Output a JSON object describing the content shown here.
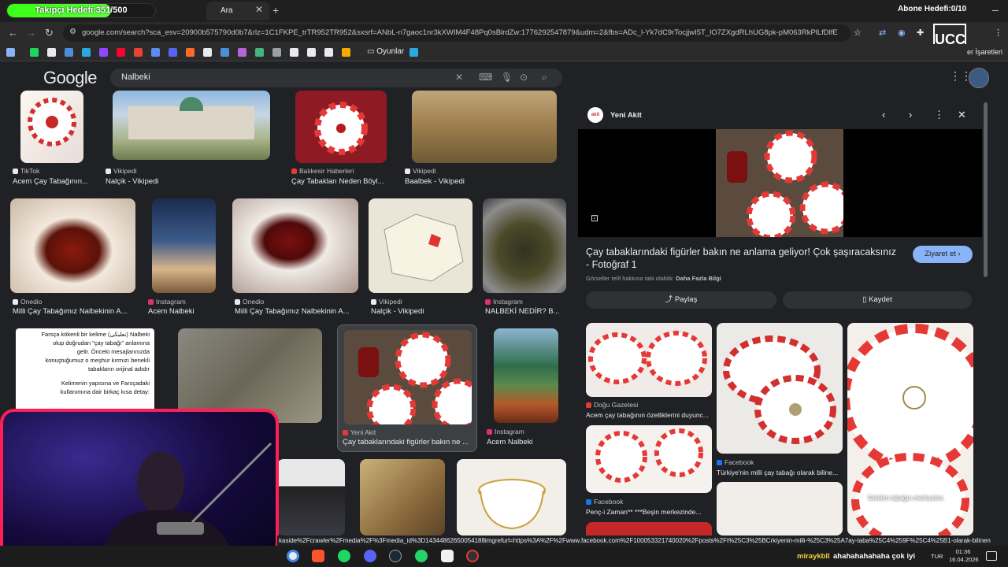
{
  "browser": {
    "goal_left": "Takipçi Hedefi:351/500",
    "goal_progress": 0.702,
    "tab_title": "Ara",
    "goal_right": "Abone Hedefi:0/10",
    "url": "google.com/search?sca_esv=20900b575790d0b7&rlz=1C1FKPE_trTR952TR952&sxsrf=ANbL-n7gaoc1nr3kXWIM4F48Pq0sBlrdZw:1776292547879&udm=2&fbs=ADc_l-Yk7dC9rTocjjwI5T_lO7ZXgdRLhUG8pk-pM063RkPlLfDlfEXPwaXG5e...",
    "bookmarks_folder": "Oyunlar",
    "other_bookmarks": "er İşaretleri"
  },
  "google": {
    "logo": "Google",
    "query": "Nalbeki"
  },
  "results": {
    "row1": [
      {
        "source": "TikTok",
        "title": "Acem Çay Tabağının..."
      },
      {
        "source": "Vikipedi",
        "title": "Nalçik - Vikipedi"
      },
      {
        "source": "Balıkesir Haberleri",
        "title": "Çay Tabakları Neden Böyl..."
      },
      {
        "source": "Vikipedi",
        "title": "Baalbek - Vikipedi"
      }
    ],
    "row2": [
      {
        "source": "Onedio",
        "title": "Milli Çay Tabağımız Nalbekinin A..."
      },
      {
        "source": "Instagram",
        "title": "Acem Nalbeki"
      },
      {
        "source": "Onedio",
        "title": "Milli Çay Tabağımız Nalbekinin A..."
      },
      {
        "source": "Vikipedi",
        "title": "Nalçik - Vikipedi"
      },
      {
        "source": "Instagram",
        "title": "NALBEKİ NEDİR? B..."
      }
    ],
    "row3": [
      {
        "source": "Yeni Akit",
        "title": "Çay tabaklarındaki figürler bakın ne ..."
      },
      {
        "source": "Instagram",
        "title": "Acem Nalbeki"
      }
    ],
    "text_card_lines": [
      "Farsça kökenli bir kelime (نعلبکی) Nalbeki",
      "olup doğrudan \"çay tabağı\" anlamına",
      "gelir. Önceki mesajlarınızda",
      "konuştuğumuz o meşhur kırmızı benekli",
      "tabakların orijinal adıdır",
      "",
      "Kelimenin yapısına ve Farsçadaki",
      "kullanımına dair birkaç kısa detay:"
    ]
  },
  "panel": {
    "source_badge": "akit",
    "source": "Yeni Akit",
    "title": "Çay tabaklarındaki figürler bakın ne anlama geliyor! Çok şaşıracaksınız - Fotoğraf 1",
    "visit": "Ziyaret et",
    "copyright": "Görseller telif hakkına tabi olabilir.",
    "more_info": "Daha Fazla Bilgi",
    "share": "Paylaş",
    "save": "Kaydet",
    "related": [
      {
        "source": "Doğu Gazetesi",
        "title": "Acem çay tabağının özelliklerini duyunc..."
      },
      {
        "source": "Facebook",
        "title": "Türkiye'nin milli çay tabağı olarak biline..."
      },
      {
        "source": "Facebook",
        "title": "Penç-i Zaman** ***Beşin merkezinde..."
      }
    ],
    "overlay_text": "Gelelim tabağın merkezine."
  },
  "status_url": "kaside%2Fcrawler%2Fmedia%2F%3Fmedia_id%3D14344862650054188imgrefurl=https%3A%2F%2Fwww.facebook.com%2F100053321740020%2Fposts%2Ft%25C3%25BCrkiyenin-milli-%25C3%25A7ay-taba%25C4%259F%25C4%25B1-olarak-bilinen-bu-al...",
  "taskbar": {
    "chat_user": "miraykbll",
    "chat_msg": "ahahahahahaha çok iyi",
    "lang": "TUR",
    "time": "01:36",
    "date": "16.04.2026"
  },
  "colors": {
    "goal_green": "#39ff14",
    "cam_border": "#ff1e56",
    "accent_blue": "#8ab4f8"
  }
}
